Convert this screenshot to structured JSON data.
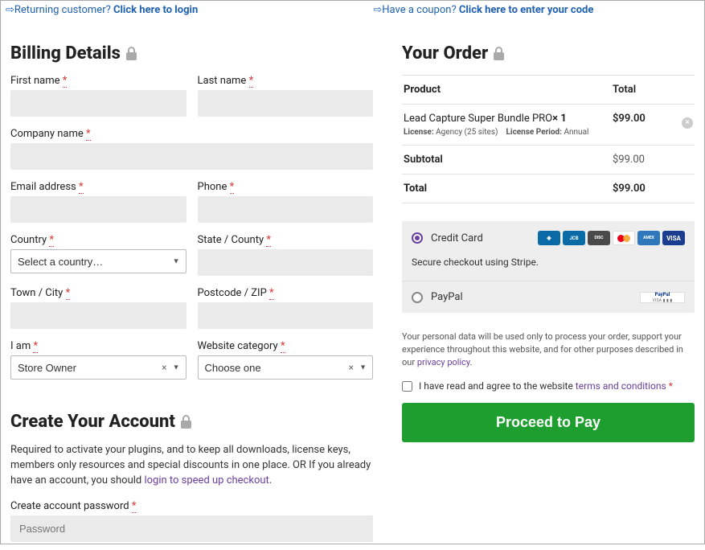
{
  "top": {
    "returning_prefix": "Returning customer? ",
    "returning_link": "Click here to login",
    "coupon_prefix": "Have a coupon? ",
    "coupon_link": "Click here to enter your code"
  },
  "billing": {
    "heading": "Billing Details",
    "first_name_label": "First name",
    "last_name_label": "Last name",
    "company_label": "Company name",
    "email_label": "Email address",
    "phone_label": "Phone",
    "country_label": "Country",
    "state_label": "State / County",
    "town_label": "Town / City",
    "postcode_label": "Postcode / ZIP",
    "iam_label": "I am",
    "website_cat_label": "Website category",
    "country_placeholder": "Select a country…",
    "iam_value": "Store Owner",
    "website_cat_value": "Choose one"
  },
  "account": {
    "heading": "Create Your Account",
    "help_prefix": "Required to activate your plugins, and to keep all downloads, license keys, members only resources and special discounts in one place. OR If you already have an account, you should ",
    "help_link": "login to speed up checkout",
    "help_suffix": ".",
    "password_label": "Create account password",
    "password_placeholder": "Password"
  },
  "order": {
    "heading": "Your Order",
    "col_product": "Product",
    "col_total": "Total",
    "item": {
      "name": "Lead Capture Super Bundle PRO",
      "qty": "× 1",
      "license_key": "License:",
      "license_val": "Agency (25 sites)",
      "period_key": "License Period:",
      "period_val": "Annual",
      "price": "$99.00"
    },
    "subtotal_label": "Subtotal",
    "subtotal_val": "$99.00",
    "total_label": "Total",
    "total_val": "$99.00"
  },
  "payment": {
    "credit_card": "Credit Card",
    "secure_note": "Secure checkout using Stripe.",
    "paypal": "PayPal"
  },
  "footer": {
    "privacy_prefix": "Your personal data will be used only to process your order, support your experience throughout this website, and for other purposes described in our ",
    "privacy_link": "privacy policy",
    "privacy_suffix": ".",
    "terms_prefix": "I have read and agree to the website ",
    "terms_link": "terms and conditions",
    "proceed": "Proceed to Pay"
  }
}
